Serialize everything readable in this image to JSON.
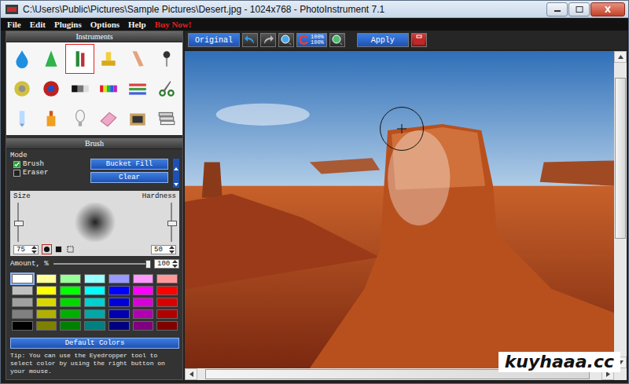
{
  "window": {
    "title": "C:\\Users\\Public\\Pictures\\Sample Pictures\\Desert.jpg - 1024x768 - PhotoInstrument 7.1"
  },
  "menu": [
    {
      "label": "File",
      "highlight": false
    },
    {
      "label": "Edit",
      "highlight": false
    },
    {
      "label": "Plugins",
      "highlight": false
    },
    {
      "label": "Options",
      "highlight": false
    },
    {
      "label": "Help",
      "highlight": false
    },
    {
      "label": "Buy Now!",
      "highlight": true
    }
  ],
  "toolbar": {
    "original": "Original",
    "zoom": [
      "100%",
      "100%"
    ],
    "apply": "Apply"
  },
  "instruments": {
    "title": "Instruments",
    "items": [
      {
        "selected": false
      },
      {
        "selected": false
      },
      {
        "selected": true
      },
      {
        "selected": false
      },
      {
        "selected": false
      },
      {
        "selected": false
      },
      {
        "selected": false
      },
      {
        "selected": false
      },
      {
        "selected": false
      },
      {
        "selected": false
      },
      {
        "selected": false
      },
      {
        "selected": false
      },
      {
        "selected": false
      },
      {
        "selected": false
      },
      {
        "selected": false
      },
      {
        "selected": false
      },
      {
        "selected": false
      },
      {
        "selected": false
      }
    ]
  },
  "brush": {
    "title": "Brush",
    "mode_label": "Mode",
    "modes": [
      {
        "label": "Brush",
        "checked": true
      },
      {
        "label": "Eraser",
        "checked": false
      }
    ],
    "buttons": [
      "Bucket Fill",
      "Clear"
    ],
    "size": {
      "label": "Size",
      "value": "75",
      "level": 0.5
    },
    "hardness": {
      "label": "Hardness",
      "value": "50",
      "level": 0.5
    },
    "shapes": [
      {
        "selected": true
      },
      {
        "selected": false
      },
      {
        "selected": false
      }
    ],
    "amount": {
      "label": "Amount, %",
      "value": "100",
      "level": 1.0
    },
    "palette": [
      [
        {
          "color": "#ffffff",
          "selected": true
        },
        {
          "color": "#ffff99",
          "selected": false
        },
        {
          "color": "#99ff99",
          "selected": false
        },
        {
          "color": "#99ffff",
          "selected": false
        },
        {
          "color": "#9999ff",
          "selected": false
        },
        {
          "color": "#ff99ff",
          "selected": false
        },
        {
          "color": "#ff9999",
          "selected": false
        }
      ],
      [
        {
          "color": "#c0c0c0",
          "selected": false
        },
        {
          "color": "#ffff00",
          "selected": false
        },
        {
          "color": "#00ff00",
          "selected": false
        },
        {
          "color": "#00ffff",
          "selected": false
        },
        {
          "color": "#0000ff",
          "selected": false
        },
        {
          "color": "#ff00ff",
          "selected": false
        },
        {
          "color": "#ff0000",
          "selected": false
        }
      ],
      [
        {
          "color": "#a0a0a0",
          "selected": false
        },
        {
          "color": "#d8d800",
          "selected": false
        },
        {
          "color": "#00d800",
          "selected": false
        },
        {
          "color": "#00d0d0",
          "selected": false
        },
        {
          "color": "#0000d8",
          "selected": false
        },
        {
          "color": "#d800d8",
          "selected": false
        },
        {
          "color": "#d80000",
          "selected": false
        }
      ],
      [
        {
          "color": "#808080",
          "selected": false
        },
        {
          "color": "#b0b000",
          "selected": false
        },
        {
          "color": "#00b000",
          "selected": false
        },
        {
          "color": "#00a8a8",
          "selected": false
        },
        {
          "color": "#0000b0",
          "selected": false
        },
        {
          "color": "#b000b0",
          "selected": false
        },
        {
          "color": "#b00000",
          "selected": false
        }
      ],
      [
        {
          "color": "#000000",
          "selected": false
        },
        {
          "color": "#808000",
          "selected": false
        },
        {
          "color": "#008000",
          "selected": false
        },
        {
          "color": "#008080",
          "selected": false
        },
        {
          "color": "#000080",
          "selected": false
        },
        {
          "color": "#800080",
          "selected": false
        },
        {
          "color": "#800000",
          "selected": false
        }
      ]
    ],
    "default_colors": "Default Colors",
    "tip": "Tip: You can use the Eyedropper tool to select color by using the right button on your mouse."
  },
  "scroll": {
    "vertical": 0.05,
    "horizontal": 0.02
  },
  "watermark": "kuyhaaa.cc"
}
